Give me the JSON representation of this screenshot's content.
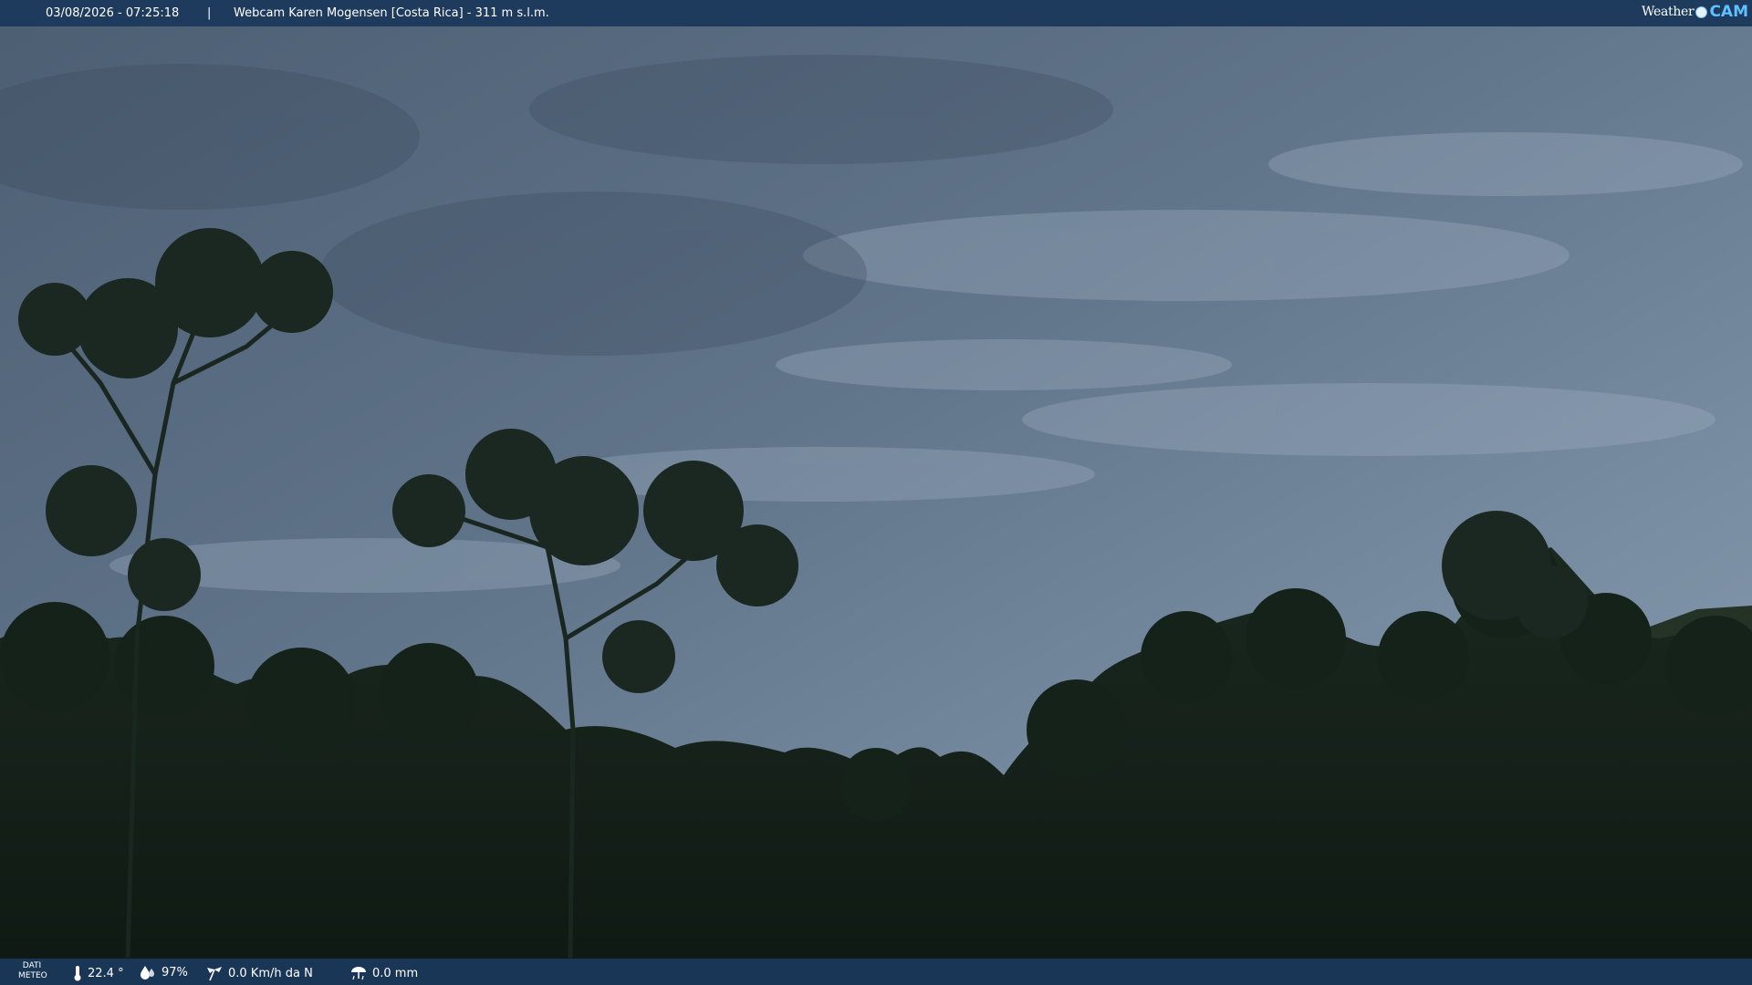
{
  "header": {
    "timestamp": "03/08/2026 - 07:25:18",
    "separator": "|",
    "title": "Webcam Karen Mogensen [Costa Rica]  - 311 m s.l.m.",
    "brand_left": "Weather",
    "brand_right": "CAM"
  },
  "footer": {
    "label_line1": "DATI",
    "label_line2": "METEO",
    "temperature": "22.4 °",
    "humidity": "97%",
    "wind": "0.0 Km/h da N",
    "rain": "0.0 mm"
  },
  "colors": {
    "bar": "#1e3a5c",
    "brand_accent": "#5fc1ff",
    "sky": "#6d8197",
    "foliage": "#142018"
  },
  "icons": [
    "thermometer-icon",
    "humidity-icon",
    "wind-icon",
    "rain-icon",
    "weathercam-logo-icon"
  ]
}
